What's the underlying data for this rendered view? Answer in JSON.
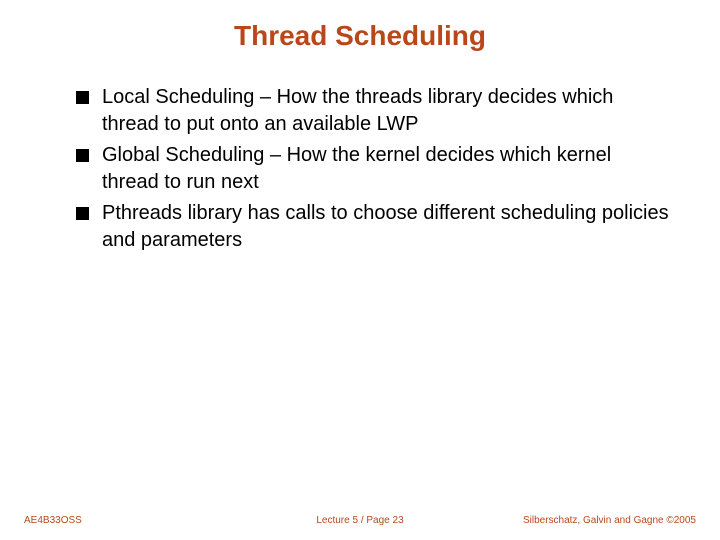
{
  "title": "Thread Scheduling",
  "bullets": [
    "Local Scheduling – How the threads library decides which thread to put onto an available LWP",
    "Global Scheduling – How the kernel decides which kernel thread to run next",
    "Pthreads library has calls to choose different scheduling policies and parameters"
  ],
  "footer": {
    "left": "AE4B33OSS",
    "center": "Lecture 5 / Page 23",
    "right": "Silberschatz, Galvin and Gagne ©2005"
  }
}
